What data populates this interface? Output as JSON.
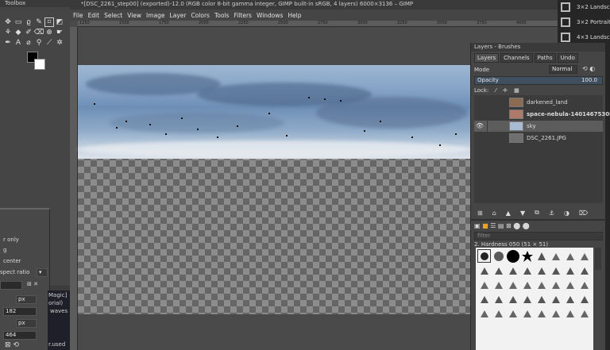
{
  "toolbox": {
    "title": "Toolbox"
  },
  "image_window": {
    "title": "*[DSC_2261_step00] (exported)-12.0 (RGB color 8-bit gamma integer, GIMP built-in sRGB, 4 layers) 6000×3136 – GIMP",
    "menus": [
      "File",
      "Edit",
      "Select",
      "View",
      "Image",
      "Layer",
      "Colors",
      "Tools",
      "Filters",
      "Windows",
      "Help"
    ],
    "ruler_ticks": [
      "1250",
      "1500",
      "1750",
      "2000",
      "2250",
      "2500",
      "2750",
      "3000",
      "3250",
      "3500",
      "3750",
      "4000"
    ]
  },
  "tool_options": {
    "line1": "r only",
    "line2": "g",
    "line3": "center",
    "aspect": "spect ratio",
    "unit1": "px",
    "val1": "182",
    "unit2": "px",
    "val2": "464",
    "code1": "Magic]",
    "code2": "orial)",
    "code3": "waves",
    "code4": "r.used"
  },
  "dock": {
    "title": "Layers - Brushes",
    "tabs": [
      "Layers",
      "Channels",
      "Paths",
      "Undo"
    ],
    "mode_label": "Mode",
    "mode_value": "Normal",
    "opacity_label": "Opacity",
    "opacity_value": "100.0",
    "lock_label": "Lock:",
    "layers": [
      {
        "name": "darkened_land",
        "visible": false,
        "selected": false,
        "thumb": "#8b6b52"
      },
      {
        "name": "space-nebula-1401467530B",
        "visible": false,
        "selected": false,
        "thumb": "#b07a6a",
        "bold": true
      },
      {
        "name": "sky",
        "visible": true,
        "selected": true,
        "thumb": "#a9bbd2"
      },
      {
        "name": "DSC_2261.JPG",
        "visible": false,
        "selected": false,
        "thumb": "#6f6f6f"
      }
    ],
    "brush_filter": "filter",
    "brush_name": "2. Hardness 050 (51 × 51)"
  },
  "right_strip": {
    "presets": [
      "3×2 Landsca",
      "3×2 Portrait",
      "4×3 Landsca"
    ]
  }
}
